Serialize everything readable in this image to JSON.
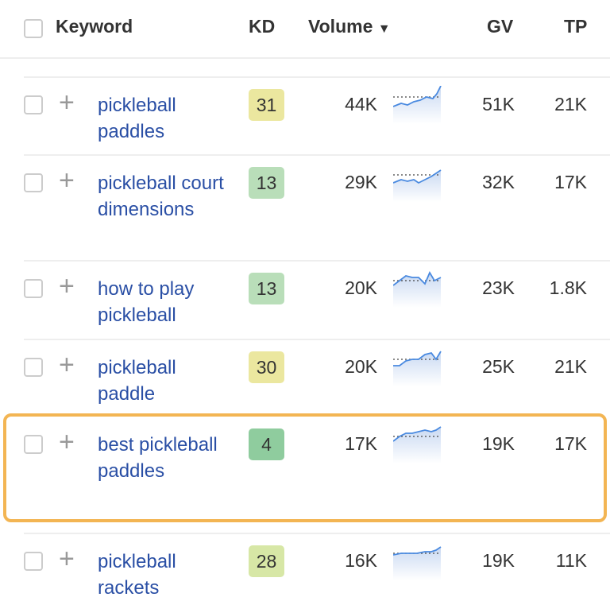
{
  "header": {
    "keyword": "Keyword",
    "kd": "KD",
    "volume": "Volume",
    "sort_icon": "sort-down-icon",
    "gv": "GV",
    "tp": "TP"
  },
  "colors": {
    "link": "#2a4fa5",
    "highlight": "#f3b553"
  },
  "rows": [
    {
      "keyword": "pickleball paddles",
      "kd": "31",
      "kd_color": "#ebe79f",
      "volume": "44K",
      "gv": "51K",
      "tp": "21K"
    },
    {
      "keyword": "pickleball court dimensions",
      "kd": "13",
      "kd_color": "#b9deb9",
      "volume": "29K",
      "gv": "32K",
      "tp": "17K"
    },
    {
      "keyword": "how to play pickleball",
      "kd": "13",
      "kd_color": "#b9deb9",
      "volume": "20K",
      "gv": "23K",
      "tp": "1.8K"
    },
    {
      "keyword": "pickleball paddle",
      "kd": "30",
      "kd_color": "#ebe79f",
      "volume": "20K",
      "gv": "25K",
      "tp": "21K"
    },
    {
      "keyword": "best pickleball paddles",
      "kd": "4",
      "kd_color": "#8fcc9e",
      "volume": "17K",
      "gv": "19K",
      "tp": "17K",
      "highlighted": true
    },
    {
      "keyword": "pickleball rackets",
      "kd": "28",
      "kd_color": "#d7e7a6",
      "volume": "16K",
      "gv": "19K",
      "tp": "11K"
    }
  ]
}
